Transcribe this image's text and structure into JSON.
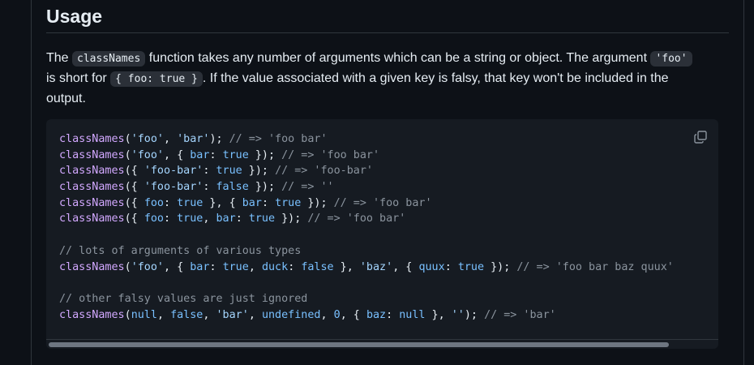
{
  "heading": "Usage",
  "desc": {
    "t1": "The ",
    "code1": "classNames",
    "t2": " function takes any number of arguments which can be a string or object. The argument ",
    "code2": "'foo'",
    "t3": " is short for ",
    "code3": "{ foo: true }",
    "t4": ". If the value associated with a given key is falsy, that key won't be included in the output."
  },
  "code_lines": [
    [
      [
        "fn",
        "classNames"
      ],
      [
        "pn",
        "("
      ],
      [
        "str",
        "'foo'"
      ],
      [
        "pn",
        ", "
      ],
      [
        "str",
        "'bar'"
      ],
      [
        "pn",
        "); "
      ],
      [
        "cm",
        "// => 'foo bar'"
      ]
    ],
    [
      [
        "fn",
        "classNames"
      ],
      [
        "pn",
        "("
      ],
      [
        "str",
        "'foo'"
      ],
      [
        "pn",
        ", { "
      ],
      [
        "kw",
        "bar"
      ],
      [
        "pn",
        ": "
      ],
      [
        "kw",
        "true"
      ],
      [
        "pn",
        " }); "
      ],
      [
        "cm",
        "// => 'foo bar'"
      ]
    ],
    [
      [
        "fn",
        "classNames"
      ],
      [
        "pn",
        "({ "
      ],
      [
        "str",
        "'foo-bar'"
      ],
      [
        "pn",
        ": "
      ],
      [
        "kw",
        "true"
      ],
      [
        "pn",
        " }); "
      ],
      [
        "cm",
        "// => 'foo-bar'"
      ]
    ],
    [
      [
        "fn",
        "classNames"
      ],
      [
        "pn",
        "({ "
      ],
      [
        "str",
        "'foo-bar'"
      ],
      [
        "pn",
        ": "
      ],
      [
        "kw",
        "false"
      ],
      [
        "pn",
        " }); "
      ],
      [
        "cm",
        "// => ''"
      ]
    ],
    [
      [
        "fn",
        "classNames"
      ],
      [
        "pn",
        "({ "
      ],
      [
        "kw",
        "foo"
      ],
      [
        "pn",
        ": "
      ],
      [
        "kw",
        "true"
      ],
      [
        "pn",
        " }, { "
      ],
      [
        "kw",
        "bar"
      ],
      [
        "pn",
        ": "
      ],
      [
        "kw",
        "true"
      ],
      [
        "pn",
        " }); "
      ],
      [
        "cm",
        "// => 'foo bar'"
      ]
    ],
    [
      [
        "fn",
        "classNames"
      ],
      [
        "pn",
        "({ "
      ],
      [
        "kw",
        "foo"
      ],
      [
        "pn",
        ": "
      ],
      [
        "kw",
        "true"
      ],
      [
        "pn",
        ", "
      ],
      [
        "kw",
        "bar"
      ],
      [
        "pn",
        ": "
      ],
      [
        "kw",
        "true"
      ],
      [
        "pn",
        " }); "
      ],
      [
        "cm",
        "// => 'foo bar'"
      ]
    ],
    [],
    [
      [
        "cm",
        "// lots of arguments of various types"
      ]
    ],
    [
      [
        "fn",
        "classNames"
      ],
      [
        "pn",
        "("
      ],
      [
        "str",
        "'foo'"
      ],
      [
        "pn",
        ", { "
      ],
      [
        "kw",
        "bar"
      ],
      [
        "pn",
        ": "
      ],
      [
        "kw",
        "true"
      ],
      [
        "pn",
        ", "
      ],
      [
        "kw",
        "duck"
      ],
      [
        "pn",
        ": "
      ],
      [
        "kw",
        "false"
      ],
      [
        "pn",
        " }, "
      ],
      [
        "str",
        "'baz'"
      ],
      [
        "pn",
        ", { "
      ],
      [
        "kw",
        "quux"
      ],
      [
        "pn",
        ": "
      ],
      [
        "kw",
        "true"
      ],
      [
        "pn",
        " }); "
      ],
      [
        "cm",
        "// => 'foo bar baz quux'"
      ]
    ],
    [],
    [
      [
        "cm",
        "// other falsy values are just ignored"
      ]
    ],
    [
      [
        "fn",
        "classNames"
      ],
      [
        "pn",
        "("
      ],
      [
        "kw",
        "null"
      ],
      [
        "pn",
        ", "
      ],
      [
        "kw",
        "false"
      ],
      [
        "pn",
        ", "
      ],
      [
        "str",
        "'bar'"
      ],
      [
        "pn",
        ", "
      ],
      [
        "kw",
        "undefined"
      ],
      [
        "pn",
        ", "
      ],
      [
        "kw",
        "0"
      ],
      [
        "pn",
        ", { "
      ],
      [
        "kw",
        "baz"
      ],
      [
        "pn",
        ": "
      ],
      [
        "kw",
        "null"
      ],
      [
        "pn",
        " }, "
      ],
      [
        "str",
        "''"
      ],
      [
        "pn",
        "); "
      ],
      [
        "cm",
        "// => 'bar'"
      ]
    ]
  ],
  "icons": {
    "copy": "copy-icon"
  },
  "colors": {
    "background": "#0d1117",
    "code_background": "#161b22",
    "function": "#d2a8ff",
    "string": "#a5d6ff",
    "keyword": "#79c0ff",
    "comment": "#8b949e"
  }
}
